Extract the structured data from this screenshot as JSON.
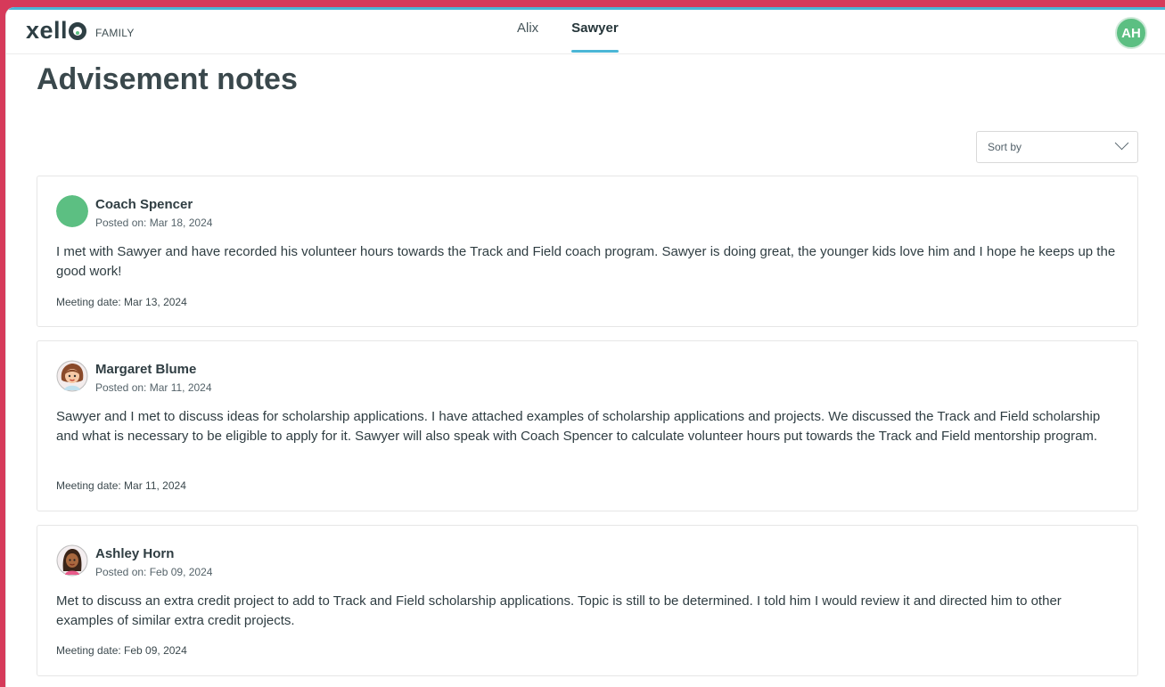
{
  "brand": {
    "name": "xello",
    "sub": "FAMILY"
  },
  "tabs": [
    {
      "label": "Alix",
      "active": false
    },
    {
      "label": "Sawyer",
      "active": true
    }
  ],
  "user": {
    "initials": "AH"
  },
  "page": {
    "title": "Advisement notes"
  },
  "sort": {
    "label": "Sort by"
  },
  "notes": [
    {
      "author": "Coach Spencer",
      "posted": "Posted on: Mar 18, 2024",
      "body": "I met with Sawyer and have recorded his volunteer hours towards the Track and Field coach program. Sawyer is doing great, the younger kids love him and I hope he keeps up the good work!",
      "meeting": "Meeting date: Mar 13, 2024",
      "avatar": "solid-green"
    },
    {
      "author": "Margaret Blume",
      "posted": "Posted on: Mar 11, 2024",
      "body": "Sawyer and I met to discuss ideas for scholarship applications. I have attached examples of scholarship applications and projects. We discussed the Track and Field scholarship and what is necessary to be eligible to apply for it. Sawyer will also speak with Coach Spencer to calculate volunteer hours put towards the Track and Field mentorship program.",
      "meeting": "Meeting date: Mar 11, 2024",
      "avatar": "illustrated-woman-brown-hair"
    },
    {
      "author": "Ashley Horn",
      "posted": "Posted on: Feb 09, 2024",
      "body": "Met to discuss an extra credit project to add to Track and Field scholarship applications. Topic is still to be determined. I told him I would review it and directed him to other examples of similar extra credit projects.",
      "meeting": "Meeting date: Feb 09, 2024",
      "avatar": "illustrated-woman-dark-hair"
    }
  ],
  "colors": {
    "accent": "#4bb6d6",
    "avatar_green": "#5cbf82",
    "window_chrome": "#d63a5a"
  }
}
